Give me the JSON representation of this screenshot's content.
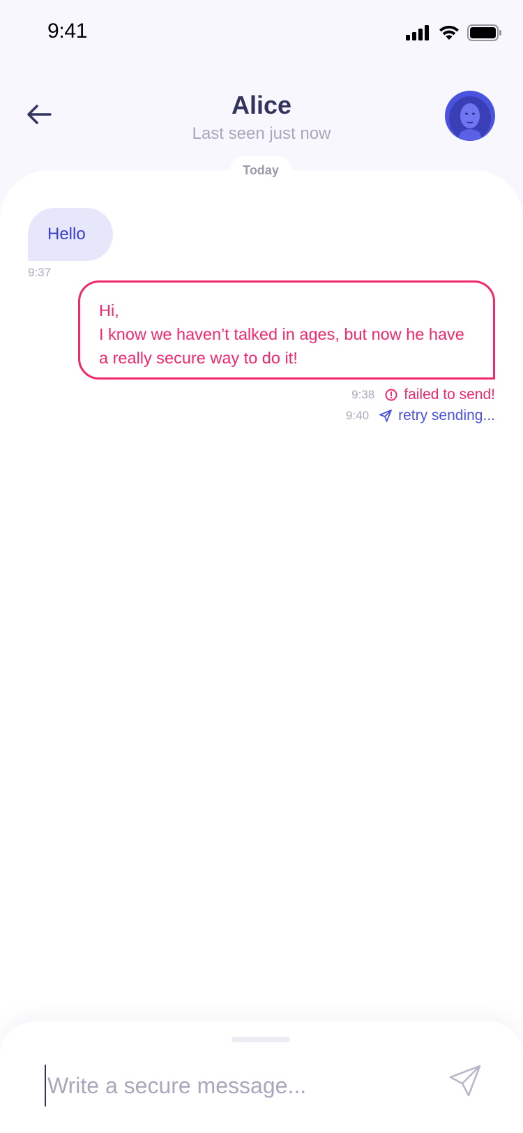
{
  "status_bar": {
    "time": "9:41",
    "icons": [
      "signal-icon",
      "wifi-icon",
      "battery-icon"
    ]
  },
  "header": {
    "back_icon": "arrow-left-icon",
    "contact_name": "Alice",
    "last_seen": "Last seen just now"
  },
  "chat": {
    "date_label": "Today",
    "messages": [
      {
        "direction": "incoming",
        "text": "Hello",
        "time": "9:37"
      },
      {
        "direction": "outgoing",
        "text": "Hi,\nI know we haven’t talked in ages, but now he have a really secure way to do it!",
        "statuses": [
          {
            "time": "9:38",
            "icon": "alert-circle-icon",
            "label": "failed to send!"
          },
          {
            "time": "9:40",
            "icon": "send-icon",
            "label": "retry sending..."
          }
        ]
      }
    ]
  },
  "composer": {
    "placeholder": "Write a secure message...",
    "value": "",
    "send_icon": "send-icon"
  },
  "colors": {
    "accent": "#4a53de",
    "error": "#f0296b",
    "title": "#31335e",
    "muted": "#a8a8bc",
    "incoming_bubble": "#e7e7fc",
    "background": "#f8f7fd"
  }
}
